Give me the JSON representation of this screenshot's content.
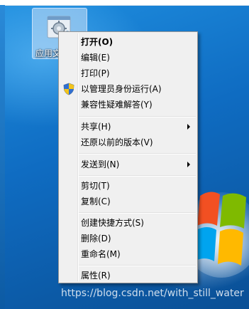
{
  "desktop": {
    "icon_label": "应用文",
    "icon_name": "settings-app-icon"
  },
  "context_menu": {
    "items": [
      {
        "label": "打开(O)",
        "bold": true
      },
      {
        "label": "编辑(E)"
      },
      {
        "label": "打印(P)"
      },
      {
        "label": "以管理员身份运行(A)",
        "icon": "uac-shield-icon"
      },
      {
        "label": "兼容性疑难解答(Y)"
      },
      {
        "label": "共享(H)",
        "submenu": true
      },
      {
        "label": "还原以前的版本(V)"
      },
      {
        "label": "发送到(N)",
        "submenu": true
      },
      {
        "label": "剪切(T)"
      },
      {
        "label": "复制(C)"
      },
      {
        "label": "创建快捷方式(S)"
      },
      {
        "label": "删除(D)"
      },
      {
        "label": "重命名(M)"
      },
      {
        "label": "属性(R)"
      }
    ]
  },
  "watermark": "https://blog.csdn.net/with_still_water",
  "colors": {
    "menu_bg": "#f0f0f0",
    "menu_border": "#979797",
    "desktop_blue": "#0f6cc2"
  }
}
